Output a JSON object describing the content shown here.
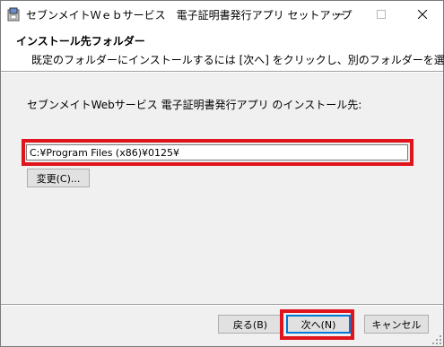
{
  "window": {
    "title": "セブンメイトＷｅｂサービス　電子証明書発行アプリ セットアップ",
    "app_icon": "installer-icon",
    "controls": {
      "minimize_icon": "minimize-icon",
      "maximize_icon": "maximize-icon",
      "close_icon": "close-icon"
    }
  },
  "header": {
    "title": "インストール先フォルダー",
    "description": "既定のフォルダーにインストールするには [次へ] をクリックし、別のフォルダーを選..."
  },
  "main": {
    "destination_label": "セブンメイトWebサービス  電子証明書発行アプリ のインストール先:",
    "install_path": "C:¥Program Files (x86)¥0125¥",
    "change_button": "変更(C)..."
  },
  "footer": {
    "back_button": "戻る(B)",
    "next_button": "次へ(N)",
    "cancel_button": "キャンセル"
  },
  "colors": {
    "highlight": "#e0141c",
    "focus": "#0078d7",
    "dialog_bg": "#f0f0f0"
  }
}
